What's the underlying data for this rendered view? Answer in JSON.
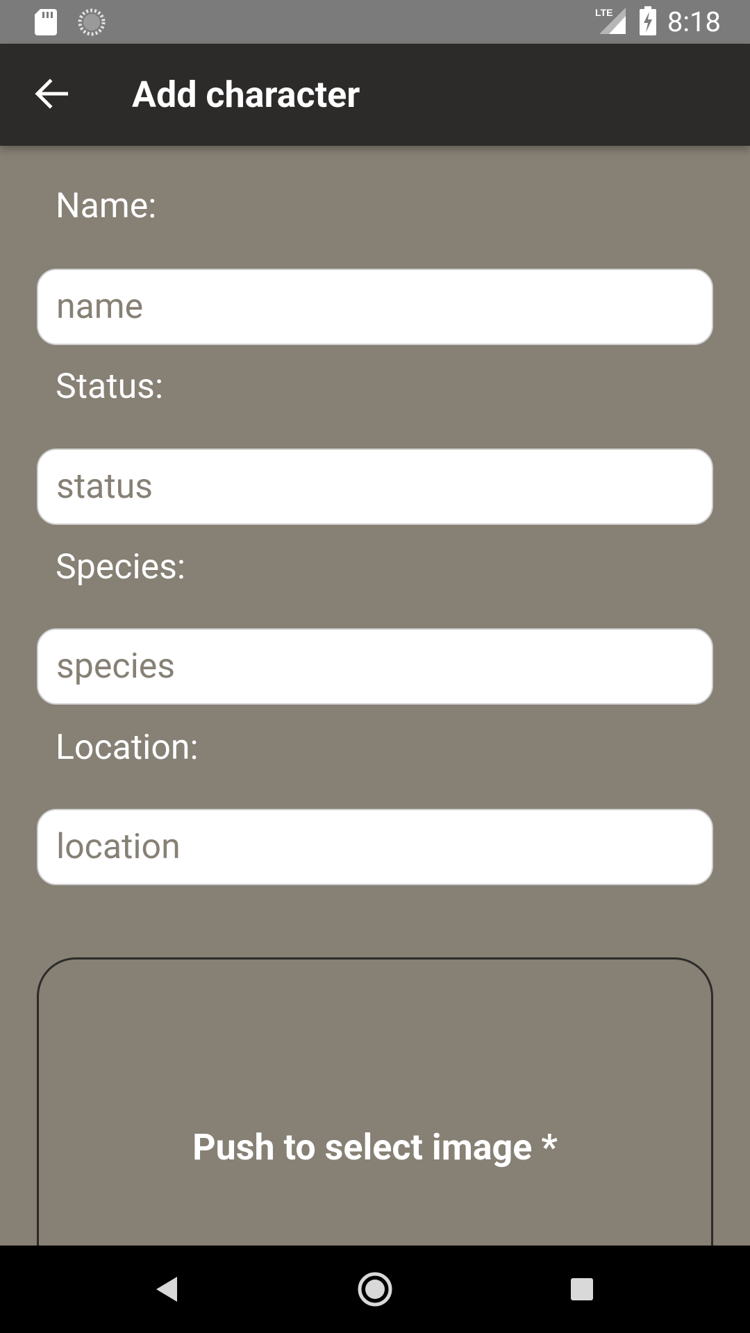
{
  "status_bar": {
    "time": "8:18",
    "network": "LTE",
    "icons": [
      "sd-card-icon",
      "sync-icon",
      "lte-signal-icon",
      "battery-charging-icon"
    ]
  },
  "app_bar": {
    "title": "Add character",
    "back_icon": "arrow-back-icon"
  },
  "form": {
    "name": {
      "label": "Name:",
      "placeholder": "name",
      "value": ""
    },
    "status": {
      "label": "Status:",
      "placeholder": "status",
      "value": ""
    },
    "species": {
      "label": "Species:",
      "placeholder": "species",
      "value": ""
    },
    "location": {
      "label": "Location:",
      "placeholder": "location",
      "value": ""
    }
  },
  "image_picker": {
    "label": "Push to select image *"
  },
  "nav_bar": {
    "icons": [
      "nav-back-icon",
      "nav-home-icon",
      "nav-recents-icon"
    ]
  },
  "colors": {
    "background": "#868075",
    "app_bar": "#2c2b29",
    "status_bar": "#7b7b7b",
    "input_bg": "#ffffff",
    "nav_bar": "#000000"
  }
}
